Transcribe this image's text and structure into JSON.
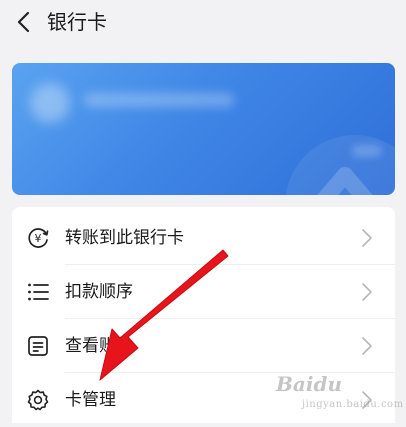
{
  "header": {
    "title": "银行卡",
    "back_icon": "chevron-left-icon"
  },
  "card": {
    "gradient_start": "#5aa3f0",
    "gradient_end": "#2f6fd8"
  },
  "menu": {
    "items": [
      {
        "label": "转账到此银行卡",
        "icon": "yuan-circle-arrow-icon"
      },
      {
        "label": "扣款顺序",
        "icon": "list-icon"
      },
      {
        "label": "查看账单",
        "icon": "document-icon"
      },
      {
        "label": "卡管理",
        "icon": "gear-icon"
      }
    ]
  },
  "annotation": {
    "arrow_color": "#e8141b"
  },
  "watermark": {
    "brand": "Baidu",
    "site": "jingyan.baidu.com"
  }
}
